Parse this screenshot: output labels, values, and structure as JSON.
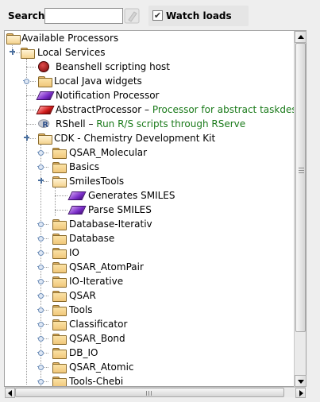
{
  "toolbar": {
    "search_label": "Search",
    "search_value": "",
    "watch_label": "Watch loads",
    "watch_checked": true,
    "check_glyph": "✔"
  },
  "tree": {
    "nodes": [
      {
        "label": "Available Processors",
        "icon": "folder-open-icon"
      },
      {
        "label": "Local Services",
        "icon": "folder-open-icon"
      },
      {
        "label": "Beanshell scripting host",
        "icon": "beanshell-icon"
      },
      {
        "label": "Local Java widgets",
        "icon": "folder-icon"
      },
      {
        "label": "Notification Processor",
        "icon": "processor-purple-icon"
      },
      {
        "label": "AbstractProcessor",
        "desc": "Processor for abstract taskdescrip",
        "icon": "processor-red-icon"
      },
      {
        "label": "RShell",
        "desc": "Run R/S scripts through RServe",
        "icon": "rshell-icon"
      },
      {
        "label": "CDK - Chemistry Development Kit",
        "icon": "folder-open-icon"
      },
      {
        "label": "QSAR_Molecular",
        "icon": "folder-icon"
      },
      {
        "label": "Basics",
        "icon": "folder-icon"
      },
      {
        "label": "SmilesTools",
        "icon": "folder-open-icon"
      },
      {
        "label": "Generates SMILES",
        "icon": "processor-purple-icon"
      },
      {
        "label": "Parse SMILES",
        "icon": "processor-purple-icon"
      },
      {
        "label": "Database-Iterativ",
        "icon": "folder-icon"
      },
      {
        "label": "Database",
        "icon": "folder-icon"
      },
      {
        "label": "IO",
        "icon": "folder-icon"
      },
      {
        "label": "QSAR_AtomPair",
        "icon": "folder-icon"
      },
      {
        "label": "IO-Iterative",
        "icon": "folder-icon"
      },
      {
        "label": "QSAR",
        "icon": "folder-icon"
      },
      {
        "label": "Tools",
        "icon": "folder-icon"
      },
      {
        "label": "Classificator",
        "icon": "folder-icon"
      },
      {
        "label": "QSAR_Bond",
        "icon": "folder-icon"
      },
      {
        "label": "DB_IO",
        "icon": "folder-icon"
      },
      {
        "label": "QSAR_Atomic",
        "icon": "folder-icon"
      },
      {
        "label": "Tools-Chebi",
        "icon": "folder-icon"
      }
    ],
    "description_separator": " – "
  },
  "colors": {
    "description_text": "#1a7a1a",
    "tree_lines": "#9a9a9a"
  }
}
